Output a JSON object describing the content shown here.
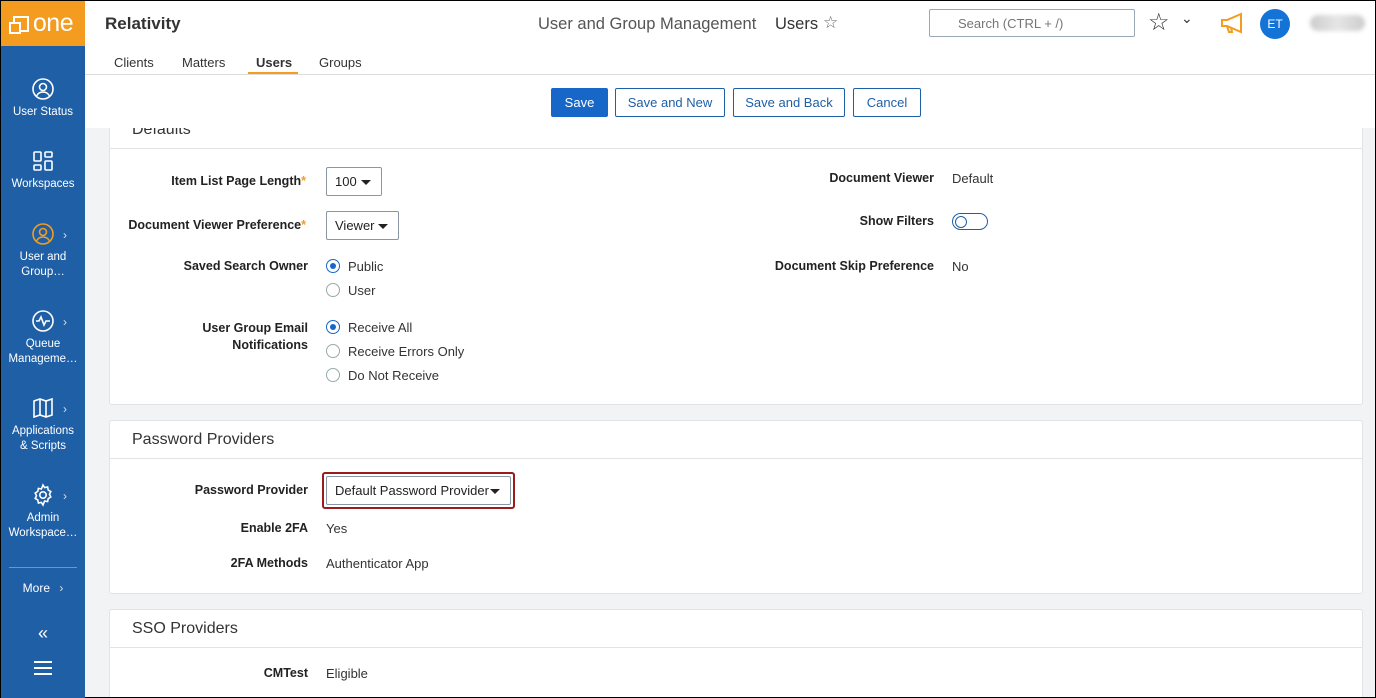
{
  "brand": {
    "name": "one"
  },
  "sidebar": {
    "items": [
      {
        "label": "User Status",
        "icon": "user-circle-icon"
      },
      {
        "label": "Workspaces",
        "icon": "grid-icon"
      },
      {
        "label": "User and Group…",
        "icon": "user-circle-icon"
      },
      {
        "label": "Queue Manageme…",
        "icon": "activity-icon"
      },
      {
        "label": "Applications & Scripts",
        "icon": "book-icon"
      },
      {
        "label": "Admin Workspace…",
        "icon": "gear-icon"
      }
    ],
    "more_label": "More",
    "more_chevron": "›",
    "collapse_glyph": "«",
    "item_chevron": "›"
  },
  "header": {
    "app_title": "Relativity",
    "breadcrumb": "User and Group Management",
    "page_title": "Users",
    "star_glyph": "☆",
    "search_placeholder": "Search (CTRL + /)",
    "favorite_glyph": "☆",
    "favorite_chevron": "⌄",
    "avatar_initials": "ET"
  },
  "tabs": [
    "Clients",
    "Matters",
    "Users",
    "Groups"
  ],
  "actions": {
    "save": "Save",
    "save_new": "Save and New",
    "save_back": "Save and Back",
    "cancel": "Cancel"
  },
  "defaults": {
    "title": "Defaults",
    "item_list_label": "Item List Page Length",
    "item_list_value": "100",
    "viewer_pref_label": "Document Viewer Preference",
    "viewer_pref_value": "Viewer",
    "required_mark": "*",
    "saved_search_label": "Saved Search Owner",
    "saved_search_options": [
      "Public",
      "User"
    ],
    "email_label_1": "User Group Email",
    "email_label_2": "Notifications",
    "email_options": [
      "Receive All",
      "Receive Errors Only",
      "Do Not Receive"
    ],
    "doc_viewer_label": "Document Viewer",
    "doc_viewer_value": "Default",
    "show_filters_label": "Show Filters",
    "show_filters_on": false,
    "skip_label": "Document Skip Preference",
    "skip_value": "No"
  },
  "password": {
    "title": "Password Providers",
    "provider_label": "Password Provider",
    "provider_value": "Default Password Provider",
    "enable_2fa_label": "Enable 2FA",
    "enable_2fa_value": "Yes",
    "methods_label": "2FA Methods",
    "methods_value": "Authenticator App"
  },
  "sso": {
    "title": "SSO Providers",
    "cm_label": "CMTest",
    "cm_value": "Eligible"
  },
  "colors": {
    "sidebar": "#1f5fa6",
    "accent": "#f39c20",
    "primary": "#1667c7",
    "highlight": "#9b1c1c"
  }
}
